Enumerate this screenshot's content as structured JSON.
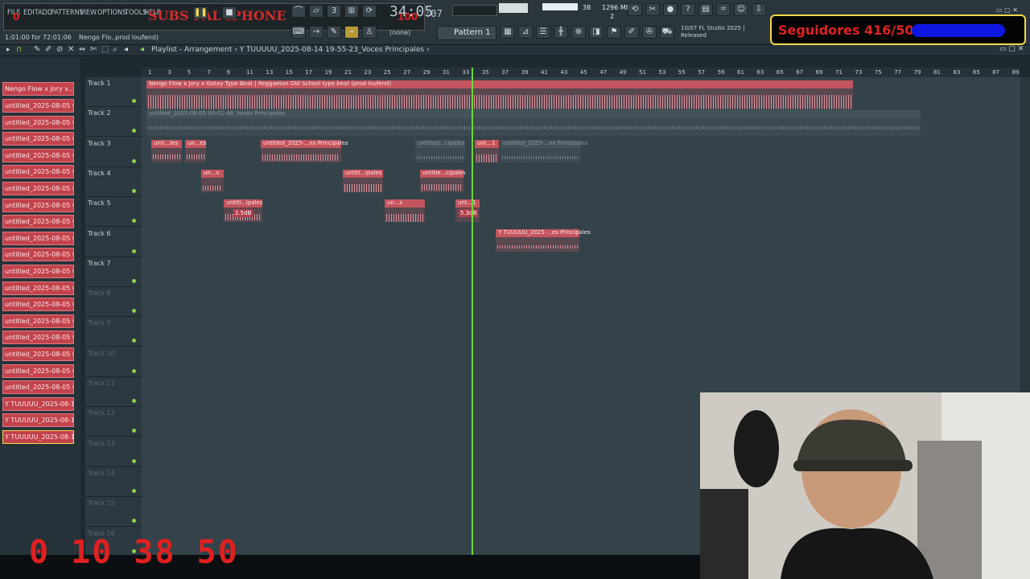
{
  "menu": [
    "FILE",
    "EDIT",
    "ADD",
    "PATTERNS",
    "VIEW",
    "OPTIONS",
    "TOOLS",
    "HELP"
  ],
  "overlay": {
    "subs": "SUBS PAL IPHONE",
    "zero": "0",
    "hundred": "100",
    "counter": "0 10 38 50"
  },
  "transport": {
    "time_pos": "1:01:00 for 72:01:06",
    "hint": "Nengo Flo..prod loufend)",
    "clock": "34:05",
    "clock_s": ":07",
    "pattern": "Pattern 1",
    "none": "(none)"
  },
  "stats": {
    "cpu": "38",
    "memory": "1296 MB",
    "voices": "2"
  },
  "news": {
    "line1": "10/07  FL Studio 2025 |",
    "line2": "Released"
  },
  "followers": {
    "text": "Seguidores 416/500",
    "progress": 0.832
  },
  "playlist": {
    "title": "Playlist - Arrangement",
    "crumb": "Y TUUUUU_2025-08-14 19-55-23_Voces Principales"
  },
  "sidebar": {
    "items": [
      "Nengo Flow x Jory x...",
      "untitled_2025-08-05 00-...",
      "untitled_2025-08-05 00-...",
      "untitled_2025-08-05 00-...",
      "untitled_2025-08-05 00-...",
      "untitled_2025-08-05 00-...",
      "untitled_2025-08-05 00-...",
      "untitled_2025-08-05 00-...",
      "untitled_2025-08-05 00-...",
      "untitled_2025-08-05 00-...",
      "untitled_2025-08-05 00-...",
      "untitled_2025-08-05 00-...",
      "untitled_2025-08-05 00-...",
      "untitled_2025-08-05 00-...",
      "untitled_2025-08-05 00-...",
      "untitled_2025-08-05 00-...",
      "untitled_2025-08-05 00-...",
      "untitled_2025-08-05 00-...",
      "untitled_2025-08-05 00-...",
      "Y TUUUUU_2025-08-14 1...",
      "Y TUUUUU_2025-08-14 1...",
      "Y TUUUUU_2025-08-14 1..."
    ]
  },
  "tracks": [
    "Track 1",
    "Track 2",
    "Track 3",
    "Track 4",
    "Track 5",
    "Track 6",
    "Track 7",
    "Track 8",
    "Track 9",
    "Track 10",
    "Track 11",
    "Track 12",
    "Track 13",
    "Track 14",
    "Track 15",
    "Track 16"
  ],
  "ruler": [
    "1",
    "3",
    "5",
    "7",
    "9",
    "11",
    "13",
    "15",
    "17",
    "19",
    "21",
    "23",
    "25",
    "27",
    "29",
    "31",
    "33",
    "35",
    "37",
    "39",
    "41",
    "43",
    "45",
    "47",
    "49",
    "51",
    "53",
    "55",
    "57",
    "59",
    "61",
    "63",
    "65",
    "67",
    "69",
    "71",
    "73",
    "75",
    "77",
    "79",
    "81",
    "83",
    "85",
    "87",
    "89"
  ],
  "clips": {
    "t1": "Nengo Flow x Jory x Gotay Type Beat | Reggaeton Old School type beat (prod loufend)",
    "t2": "untitled_2025-08-05 00-01-46_Voces Principales",
    "t3a": "unti...les",
    "t3b": "un...es",
    "t3c": "untitled_2025-...es Principales",
    "t3d": "untitled...cipales",
    "t3e": "unt...1",
    "t3f": "untitled_2025-...es Principales",
    "t4a": "un...s",
    "t4b": "untitl...ipales",
    "t4c": "untitle...cipales",
    "t5a": "untitl...ipales",
    "t5b": "un...s",
    "t5c": "unt...1",
    "t6a": "Y TUUUUU_2025-...es Principales",
    "vol1": "2.5dB",
    "vol2": "5.3dB"
  }
}
